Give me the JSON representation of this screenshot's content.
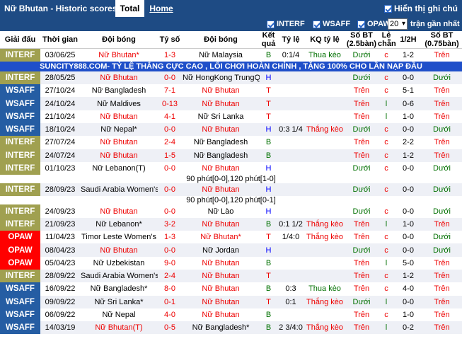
{
  "header": {
    "title": "Nữ Bhutan - Historic scores",
    "tab_total": "Total",
    "tab_home": "Home",
    "show_all": "Hiển thị ghi chú"
  },
  "filters": {
    "f1": "INTERF",
    "f2": "WSAFF",
    "f3": "OPAW",
    "count": "20",
    "count_label": "trận gần nhất"
  },
  "columns": [
    "Giải đấu",
    "Thời gian",
    "Đội bóng",
    "Tỷ số",
    "Đội bóng",
    "Kết quả",
    "Tỷ lệ",
    "KQ tỷ lệ",
    "Số BT (2.5bàn)",
    "Lẻ chẵn",
    "1/2H",
    "Số BT (0.75bàn)"
  ],
  "banner": "SUNCITY888.COM- TỶ LỆ THẮNG CỰC CAO , LỐI CHƠI HOÀN CHỈNH , TẶNG 100% CHO LẦN NẠP ĐẦU",
  "notes": [
    "90 phút[0-0],120 phút[1-0]",
    "90 phút[0-0],120 phút[0-1]"
  ],
  "rows": [
    {
      "league": "INTERF",
      "date": "03/06/25",
      "home": "Nữ Bhutan*",
      "score": "1-3",
      "away": "Nữ Malaysia",
      "res": "B",
      "odds": "0:1/4",
      "oddres": "Thua kèo",
      "ou": "Dưới",
      "oe": "c",
      "half": "1-2",
      "ou2": "Trên"
    },
    {
      "league": "INTERF",
      "date": "28/05/25",
      "home": "Nữ Bhutan",
      "score": "0-0",
      "away": "Nữ HongKong TrungQuốc",
      "res": "H",
      "odds": "",
      "oddres": "",
      "ou": "Dưới",
      "oe": "c",
      "half": "0-0",
      "ou2": "Dưới"
    },
    {
      "league": "WSAFF",
      "date": "27/10/24",
      "home": "Nữ Bangladesh",
      "score": "7-1",
      "away": "Nữ Bhutan",
      "res": "T",
      "odds": "",
      "oddres": "",
      "ou": "Trên",
      "oe": "c",
      "half": "5-1",
      "ou2": "Trên"
    },
    {
      "league": "WSAFF",
      "date": "24/10/24",
      "home": "Nữ Maldives",
      "score": "0-13",
      "away": "Nữ Bhutan",
      "res": "T",
      "odds": "",
      "oddres": "",
      "ou": "Trên",
      "oe": "l",
      "half": "0-6",
      "ou2": "Trên"
    },
    {
      "league": "WSAFF",
      "date": "21/10/24",
      "home": "Nữ Bhutan",
      "score": "4-1",
      "away": "Nữ Sri Lanka",
      "res": "T",
      "odds": "",
      "oddres": "",
      "ou": "Trên",
      "oe": "l",
      "half": "1-0",
      "ou2": "Trên"
    },
    {
      "league": "WSAFF",
      "date": "18/10/24",
      "home": "Nữ Nepal*",
      "score": "0-0",
      "away": "Nữ Bhutan",
      "res": "H",
      "odds": "0:3 1/4",
      "oddres": "Thắng kèo",
      "ou": "Dưới",
      "oe": "c",
      "half": "0-0",
      "ou2": "Dưới"
    },
    {
      "league": "INTERF",
      "date": "27/07/24",
      "home": "Nữ Bhutan",
      "score": "2-4",
      "away": "Nữ Bangladesh",
      "res": "B",
      "odds": "",
      "oddres": "",
      "ou": "Trên",
      "oe": "c",
      "half": "2-2",
      "ou2": "Trên"
    },
    {
      "league": "INTERF",
      "date": "24/07/24",
      "home": "Nữ Bhutan",
      "score": "1-5",
      "away": "Nữ Bangladesh",
      "res": "B",
      "odds": "",
      "oddres": "",
      "ou": "Trên",
      "oe": "c",
      "half": "1-2",
      "ou2": "Trên"
    },
    {
      "league": "INTERF",
      "date": "01/10/23",
      "home": "Nữ Lebanon(T)",
      "score": "0-0",
      "away": "Nữ Bhutan",
      "res": "H",
      "odds": "",
      "oddres": "",
      "ou": "Dưới",
      "oe": "c",
      "half": "0-0",
      "ou2": "Dưới"
    },
    {
      "league": "INTERF",
      "date": "28/09/23",
      "home": "Saudi Arabia Women's",
      "score": "0-0",
      "away": "Nữ Bhutan",
      "res": "H",
      "odds": "",
      "oddres": "",
      "ou": "Dưới",
      "oe": "c",
      "half": "0-0",
      "ou2": "Dưới"
    },
    {
      "league": "INTERF",
      "date": "24/09/23",
      "home": "Nữ Bhutan",
      "score": "0-0",
      "away": "Nữ Lào",
      "res": "H",
      "odds": "",
      "oddres": "",
      "ou": "Dưới",
      "oe": "c",
      "half": "0-0",
      "ou2": "Dưới"
    },
    {
      "league": "INTERF",
      "date": "21/09/23",
      "home": "Nữ Lebanon*",
      "score": "3-2",
      "away": "Nữ Bhutan",
      "res": "B",
      "odds": "0:1 1/2",
      "oddres": "Thắng kèo",
      "ou": "Trên",
      "oe": "l",
      "half": "1-0",
      "ou2": "Trên"
    },
    {
      "league": "OPAW",
      "date": "11/04/23",
      "home": "Timor Leste Women's",
      "score": "1-3",
      "away": "Nữ Bhutan*",
      "res": "T",
      "odds": "1/4:0",
      "oddres": "Thắng kèo",
      "ou": "Trên",
      "oe": "c",
      "half": "0-0",
      "ou2": "Dưới"
    },
    {
      "league": "OPAW",
      "date": "08/04/23",
      "home": "Nữ Bhutan",
      "score": "0-0",
      "away": "Nữ Jordan",
      "res": "H",
      "odds": "",
      "oddres": "",
      "ou": "Dưới",
      "oe": "c",
      "half": "0-0",
      "ou2": "Dưới"
    },
    {
      "league": "OPAW",
      "date": "05/04/23",
      "home": "Nữ Uzbekistan",
      "score": "9-0",
      "away": "Nữ Bhutan",
      "res": "B",
      "odds": "",
      "oddres": "",
      "ou": "Trên",
      "oe": "l",
      "half": "5-0",
      "ou2": "Trên"
    },
    {
      "league": "INTERF",
      "date": "28/09/22",
      "home": "Saudi Arabia Women's",
      "score": "2-4",
      "away": "Nữ Bhutan",
      "res": "T",
      "odds": "",
      "oddres": "",
      "ou": "Trên",
      "oe": "c",
      "half": "1-2",
      "ou2": "Trên"
    },
    {
      "league": "WSAFF",
      "date": "16/09/22",
      "home": "Nữ Bangladesh*",
      "score": "8-0",
      "away": "Nữ Bhutan",
      "res": "B",
      "odds": "0:3",
      "oddres": "Thua kèo",
      "ou": "Trên",
      "oe": "c",
      "half": "4-0",
      "ou2": "Trên"
    },
    {
      "league": "WSAFF",
      "date": "09/09/22",
      "home": "Nữ Sri Lanka*",
      "score": "0-1",
      "away": "Nữ Bhutan",
      "res": "T",
      "odds": "0:1",
      "oddres": "Thắng kèo",
      "ou": "Dưới",
      "oe": "l",
      "half": "0-0",
      "ou2": "Trên"
    },
    {
      "league": "WSAFF",
      "date": "06/09/22",
      "home": "Nữ Nepal",
      "score": "4-0",
      "away": "Nữ Bhutan",
      "res": "B",
      "odds": "",
      "oddres": "",
      "ou": "Trên",
      "oe": "c",
      "half": "1-0",
      "ou2": "Trên"
    },
    {
      "league": "WSAFF",
      "date": "14/03/19",
      "home": "Nữ Bhutan(T)",
      "score": "0-5",
      "away": "Nữ Bangladesh*",
      "res": "B",
      "odds": "2 3/4:0",
      "oddres": "Thắng kèo",
      "ou": "Trên",
      "oe": "l",
      "half": "0-2",
      "ou2": "Trên"
    }
  ]
}
